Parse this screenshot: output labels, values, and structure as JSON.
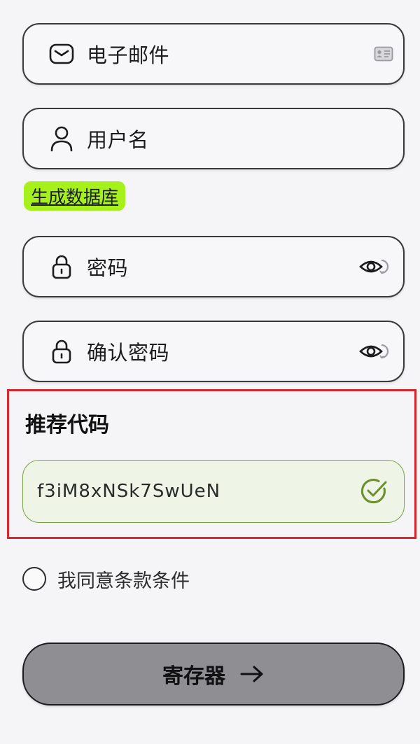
{
  "fields": {
    "email": {
      "placeholder": "电子邮件",
      "icon": "mail-icon",
      "trailing_icon": "contact-card-icon"
    },
    "username": {
      "placeholder": "用户名",
      "icon": "user-icon"
    },
    "password": {
      "placeholder": "密码",
      "icon": "lock-icon",
      "trailing_icon": "eye-icon"
    },
    "confirm_password": {
      "placeholder": "确认密码",
      "icon": "lock-icon",
      "trailing_icon": "eye-icon"
    }
  },
  "generate_link": {
    "label": "生成数据库",
    "highlight_color": "#a6f01c"
  },
  "referral": {
    "title": "推荐代码",
    "value": "f3iM8xNSk7SwUeN",
    "status_icon": "check-circle-icon",
    "status_color": "#6b8f2a",
    "highlight_border_color": "#d6262e"
  },
  "terms": {
    "label": "我同意条款条件",
    "checked": false
  },
  "submit": {
    "label": "寄存器",
    "icon": "arrow-right-icon"
  }
}
